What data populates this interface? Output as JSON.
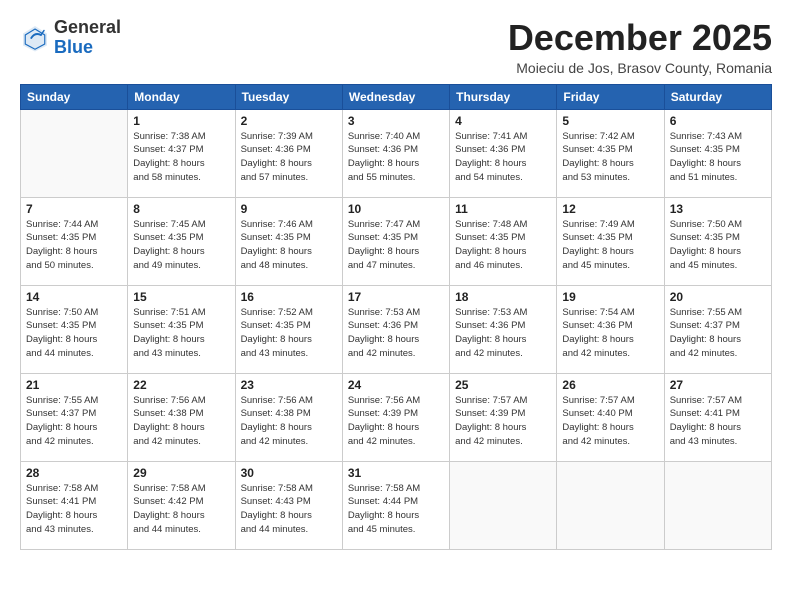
{
  "header": {
    "logo_general": "General",
    "logo_blue": "Blue",
    "month_title": "December 2025",
    "subtitle": "Moieciu de Jos, Brasov County, Romania"
  },
  "weekdays": [
    "Sunday",
    "Monday",
    "Tuesday",
    "Wednesday",
    "Thursday",
    "Friday",
    "Saturday"
  ],
  "weeks": [
    [
      {
        "day": "",
        "text": ""
      },
      {
        "day": "1",
        "text": "Sunrise: 7:38 AM\nSunset: 4:37 PM\nDaylight: 8 hours\nand 58 minutes."
      },
      {
        "day": "2",
        "text": "Sunrise: 7:39 AM\nSunset: 4:36 PM\nDaylight: 8 hours\nand 57 minutes."
      },
      {
        "day": "3",
        "text": "Sunrise: 7:40 AM\nSunset: 4:36 PM\nDaylight: 8 hours\nand 55 minutes."
      },
      {
        "day": "4",
        "text": "Sunrise: 7:41 AM\nSunset: 4:36 PM\nDaylight: 8 hours\nand 54 minutes."
      },
      {
        "day": "5",
        "text": "Sunrise: 7:42 AM\nSunset: 4:35 PM\nDaylight: 8 hours\nand 53 minutes."
      },
      {
        "day": "6",
        "text": "Sunrise: 7:43 AM\nSunset: 4:35 PM\nDaylight: 8 hours\nand 51 minutes."
      }
    ],
    [
      {
        "day": "7",
        "text": "Sunrise: 7:44 AM\nSunset: 4:35 PM\nDaylight: 8 hours\nand 50 minutes."
      },
      {
        "day": "8",
        "text": "Sunrise: 7:45 AM\nSunset: 4:35 PM\nDaylight: 8 hours\nand 49 minutes."
      },
      {
        "day": "9",
        "text": "Sunrise: 7:46 AM\nSunset: 4:35 PM\nDaylight: 8 hours\nand 48 minutes."
      },
      {
        "day": "10",
        "text": "Sunrise: 7:47 AM\nSunset: 4:35 PM\nDaylight: 8 hours\nand 47 minutes."
      },
      {
        "day": "11",
        "text": "Sunrise: 7:48 AM\nSunset: 4:35 PM\nDaylight: 8 hours\nand 46 minutes."
      },
      {
        "day": "12",
        "text": "Sunrise: 7:49 AM\nSunset: 4:35 PM\nDaylight: 8 hours\nand 45 minutes."
      },
      {
        "day": "13",
        "text": "Sunrise: 7:50 AM\nSunset: 4:35 PM\nDaylight: 8 hours\nand 45 minutes."
      }
    ],
    [
      {
        "day": "14",
        "text": "Sunrise: 7:50 AM\nSunset: 4:35 PM\nDaylight: 8 hours\nand 44 minutes."
      },
      {
        "day": "15",
        "text": "Sunrise: 7:51 AM\nSunset: 4:35 PM\nDaylight: 8 hours\nand 43 minutes."
      },
      {
        "day": "16",
        "text": "Sunrise: 7:52 AM\nSunset: 4:35 PM\nDaylight: 8 hours\nand 43 minutes."
      },
      {
        "day": "17",
        "text": "Sunrise: 7:53 AM\nSunset: 4:36 PM\nDaylight: 8 hours\nand 42 minutes."
      },
      {
        "day": "18",
        "text": "Sunrise: 7:53 AM\nSunset: 4:36 PM\nDaylight: 8 hours\nand 42 minutes."
      },
      {
        "day": "19",
        "text": "Sunrise: 7:54 AM\nSunset: 4:36 PM\nDaylight: 8 hours\nand 42 minutes."
      },
      {
        "day": "20",
        "text": "Sunrise: 7:55 AM\nSunset: 4:37 PM\nDaylight: 8 hours\nand 42 minutes."
      }
    ],
    [
      {
        "day": "21",
        "text": "Sunrise: 7:55 AM\nSunset: 4:37 PM\nDaylight: 8 hours\nand 42 minutes."
      },
      {
        "day": "22",
        "text": "Sunrise: 7:56 AM\nSunset: 4:38 PM\nDaylight: 8 hours\nand 42 minutes."
      },
      {
        "day": "23",
        "text": "Sunrise: 7:56 AM\nSunset: 4:38 PM\nDaylight: 8 hours\nand 42 minutes."
      },
      {
        "day": "24",
        "text": "Sunrise: 7:56 AM\nSunset: 4:39 PM\nDaylight: 8 hours\nand 42 minutes."
      },
      {
        "day": "25",
        "text": "Sunrise: 7:57 AM\nSunset: 4:39 PM\nDaylight: 8 hours\nand 42 minutes."
      },
      {
        "day": "26",
        "text": "Sunrise: 7:57 AM\nSunset: 4:40 PM\nDaylight: 8 hours\nand 42 minutes."
      },
      {
        "day": "27",
        "text": "Sunrise: 7:57 AM\nSunset: 4:41 PM\nDaylight: 8 hours\nand 43 minutes."
      }
    ],
    [
      {
        "day": "28",
        "text": "Sunrise: 7:58 AM\nSunset: 4:41 PM\nDaylight: 8 hours\nand 43 minutes."
      },
      {
        "day": "29",
        "text": "Sunrise: 7:58 AM\nSunset: 4:42 PM\nDaylight: 8 hours\nand 44 minutes."
      },
      {
        "day": "30",
        "text": "Sunrise: 7:58 AM\nSunset: 4:43 PM\nDaylight: 8 hours\nand 44 minutes."
      },
      {
        "day": "31",
        "text": "Sunrise: 7:58 AM\nSunset: 4:44 PM\nDaylight: 8 hours\nand 45 minutes."
      },
      {
        "day": "",
        "text": ""
      },
      {
        "day": "",
        "text": ""
      },
      {
        "day": "",
        "text": ""
      }
    ]
  ]
}
